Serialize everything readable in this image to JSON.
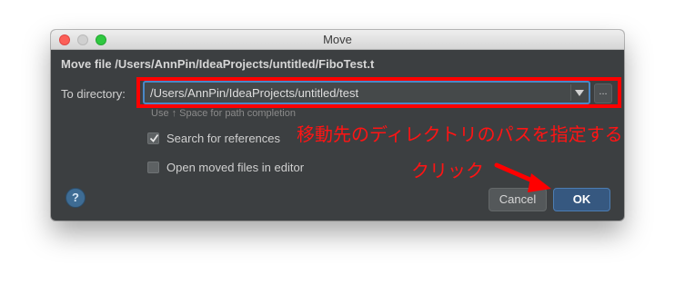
{
  "window": {
    "title": "Move",
    "heading": "Move file /Users/AnnPin/IdeaProjects/untitled/FiboTest.t"
  },
  "directory": {
    "label": "To directory:",
    "value": "/Users/AnnPin/IdeaProjects/untitled/test",
    "hint": "Use ↑ Space for path completion",
    "browse_label": "..."
  },
  "options": [
    {
      "label": "Search for references",
      "checked": true
    },
    {
      "label": "Open moved files in editor",
      "checked": false
    }
  ],
  "footer": {
    "help_label": "?",
    "cancel_label": "Cancel",
    "ok_label": "OK"
  },
  "annotations": {
    "note_directory": "移動先のディレクトリのパスを指定する",
    "note_click": "クリック",
    "color": "#ff0000"
  },
  "colors": {
    "dialog_bg": "#3c3f41",
    "accent": "#4a88c7",
    "ok_button": "#365880"
  }
}
